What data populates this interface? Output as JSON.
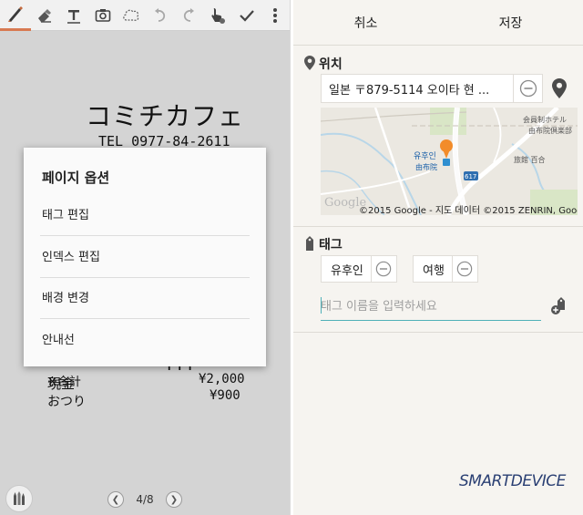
{
  "left": {
    "toolbar": {
      "tools": [
        "pen-icon",
        "eraser-icon",
        "text-icon",
        "camera-icon",
        "lasso-icon",
        "undo-icon",
        "redo-icon",
        "select-icon",
        "check-icon",
        "more-icon"
      ]
    },
    "receipt": {
      "shop_name": "コミチカフェ",
      "tel": "TEL 0977-84-2611",
      "line_total": "¥¥¥",
      "line_label_1": "※合計",
      "line_label_2": "現金",
      "line_label_3": "おつり",
      "value_2": "¥2,000",
      "value_3": "¥900"
    },
    "dialog": {
      "title": "페이지 옵션",
      "items": [
        "태그 편집",
        "인덱스 편집",
        "배경 변경",
        "안내선"
      ]
    },
    "pager": {
      "indicator": "4/8"
    }
  },
  "right": {
    "topbar": {
      "cancel": "취소",
      "save": "저장"
    },
    "location": {
      "label": "위치",
      "value": "일본 〒879-5114 오이타 현 ...",
      "map_place": "유후인",
      "map_place_jp": "由布院",
      "map_copyright": "©2015 Google - 지도 데이터 ©2015 ZENRIN, Google",
      "map_road": "617",
      "map_jp_1": "会員制ホテル",
      "map_jp_2": "由布院倶楽部",
      "map_jp_3": "旅館 百合",
      "map_logo": "Google"
    },
    "tags": {
      "label": "태그",
      "items": [
        "유후인",
        "여행"
      ],
      "placeholder": "태그 이름을 입력하세요"
    },
    "brand": "SMARTDEVICE"
  },
  "colors": {
    "accent_teal": "#4fb0b8",
    "pen_accent": "#d87a52",
    "map_marker": "#f28c2a",
    "brand_blue": "#2a3f73"
  }
}
